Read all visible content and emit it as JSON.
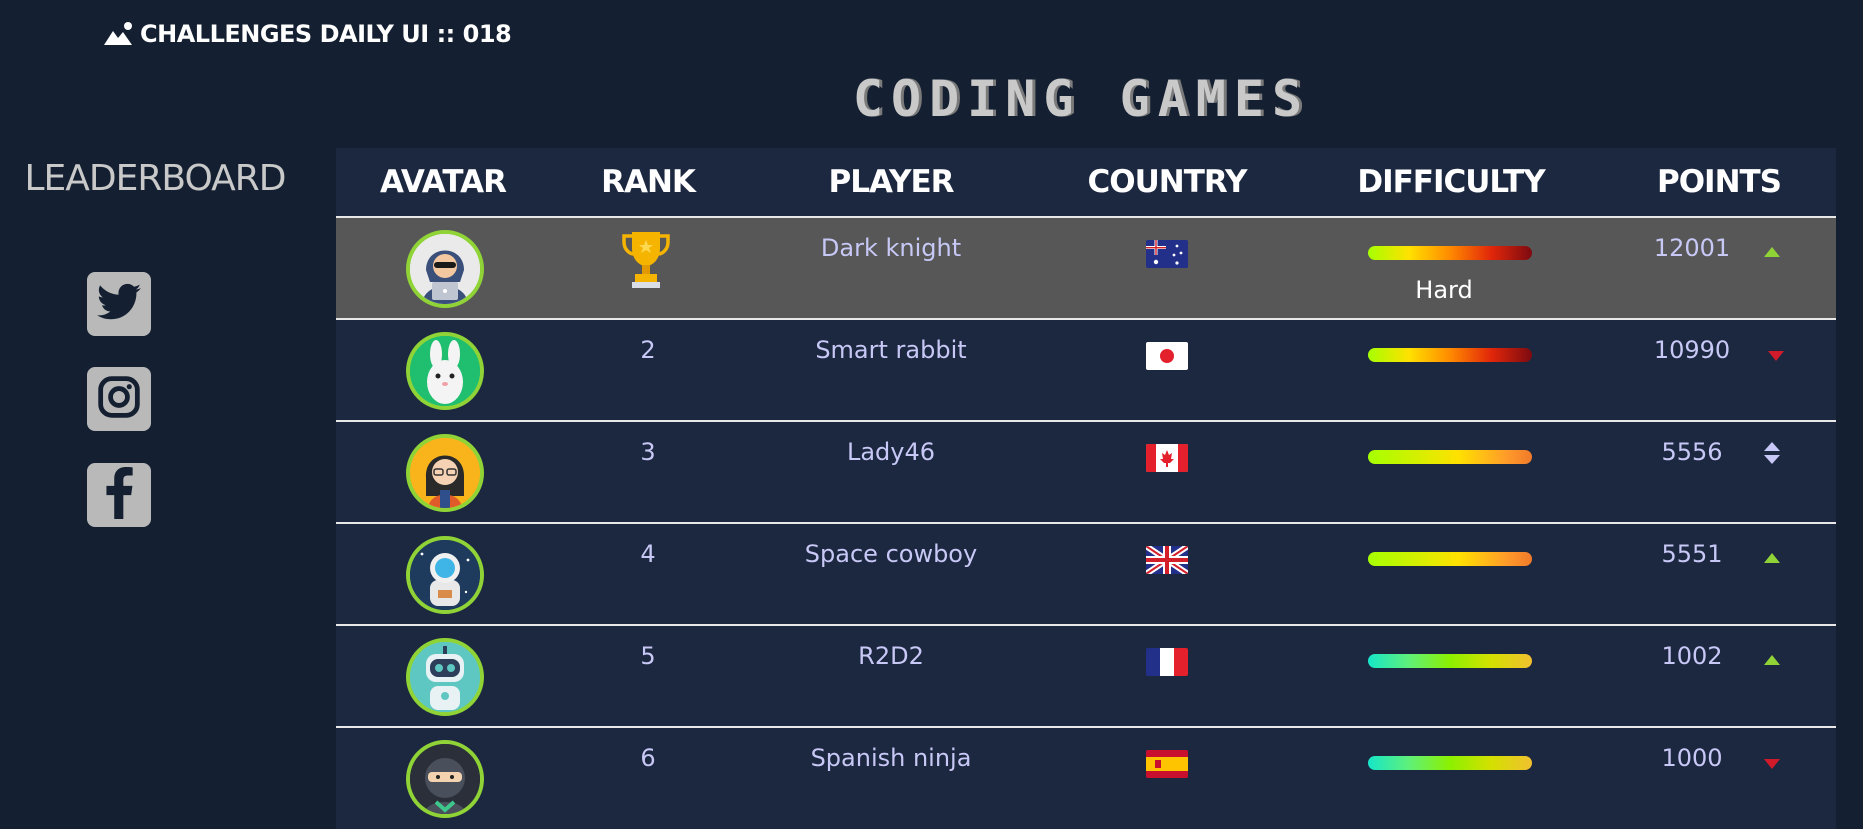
{
  "header": {
    "title": "CHALLENGES DAILY UI :: 018"
  },
  "main": {
    "title": "CODING GAMES"
  },
  "sidebar": {
    "title": "LEADERBOARD",
    "social": [
      {
        "icon": "twitter-icon"
      },
      {
        "icon": "instagram-icon"
      },
      {
        "icon": "facebook-icon"
      }
    ]
  },
  "table": {
    "columns": [
      "AVATAR",
      "RANK",
      "PLAYER",
      "COUNTRY",
      "DIFFICULTY",
      "POINTS"
    ],
    "rows": [
      {
        "rank": "",
        "rank_icon": "trophy-icon",
        "player": "Dark knight",
        "country_flag": "australia-flag-icon",
        "difficulty_label": "Hard",
        "points": "12001",
        "trend": "up",
        "avatar": "hacker-avatar"
      },
      {
        "rank": "2",
        "player": "Smart rabbit",
        "country_flag": "japan-flag-icon",
        "difficulty_label": "",
        "points": "10990",
        "trend": "down",
        "avatar": "rabbit-avatar"
      },
      {
        "rank": "3",
        "player": "Lady46",
        "country_flag": "canada-flag-icon",
        "difficulty_label": "",
        "points": "5556",
        "trend": "same",
        "avatar": "woman-avatar"
      },
      {
        "rank": "4",
        "player": "Space cowboy",
        "country_flag": "uk-flag-icon",
        "difficulty_label": "",
        "points": "5551",
        "trend": "up",
        "avatar": "astronaut-avatar"
      },
      {
        "rank": "5",
        "player": "R2D2",
        "country_flag": "france-flag-icon",
        "difficulty_label": "",
        "points": "1002",
        "trend": "up",
        "avatar": "robot-avatar"
      },
      {
        "rank": "6",
        "player": "Spanish ninja",
        "country_flag": "spain-flag-icon",
        "difficulty_label": "",
        "points": "1000",
        "trend": "down",
        "avatar": "ninja-avatar"
      }
    ]
  },
  "colors": {
    "background": "#142031",
    "table": "#1c2740",
    "highlight_row": "#575757",
    "trend_up": "#8fd337",
    "trend_down": "#d11a2a",
    "trend_same": "#c7c8f5"
  }
}
